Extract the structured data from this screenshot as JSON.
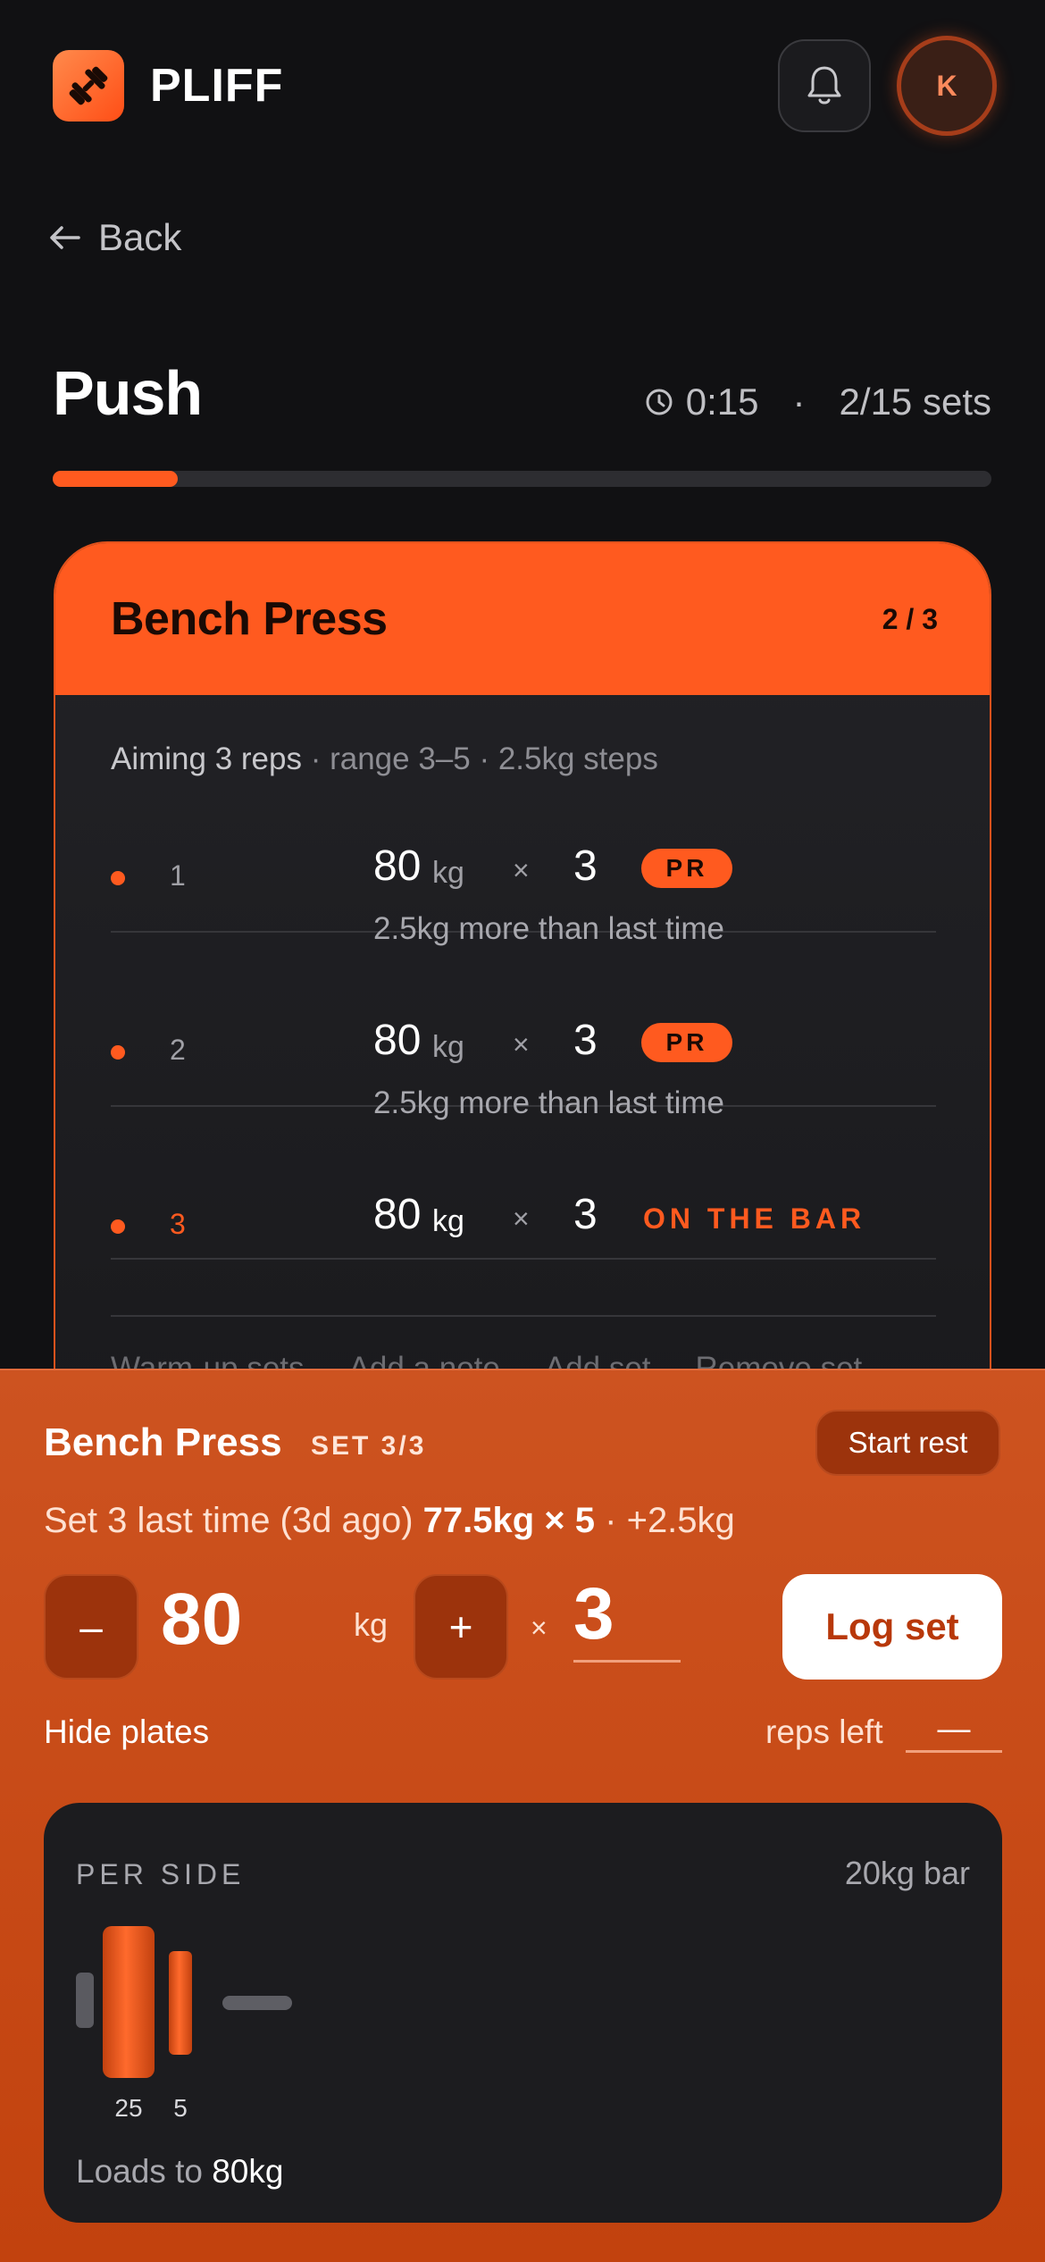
{
  "header": {
    "app_name": "PLIFF",
    "avatar_initial": "K"
  },
  "nav": {
    "back_label": "Back"
  },
  "workout": {
    "title": "Push",
    "timer": "0:15",
    "separator": "·",
    "sets_progress": "2/15 sets",
    "progress_fraction": 0.133
  },
  "exercise_card": {
    "name": "Bench Press",
    "count": "2 / 3",
    "aim_main": "Aiming 3 reps",
    "aim_extra": " · range 3–5 · 2.5kg steps",
    "sets": [
      {
        "number": "1",
        "weight": "80",
        "unit": "kg",
        "times": "×",
        "reps": "3",
        "badge": "PR",
        "note": "2.5kg more than last time"
      },
      {
        "number": "2",
        "weight": "80",
        "unit": "kg",
        "times": "×",
        "reps": "3",
        "badge": "PR",
        "note": "2.5kg more than last time"
      },
      {
        "number": "3",
        "weight": "80",
        "unit": "kg",
        "times": "×",
        "reps": "3",
        "status": "ON THE BAR"
      }
    ],
    "actions": [
      "Warm-up sets",
      "Add a note",
      "Add set",
      "Remove set"
    ]
  },
  "logger": {
    "exercise": "Bench Press",
    "set_label": "SET 3/3",
    "start_rest_label": "Start rest",
    "last_time_prefix": "Set 3 last time (3d ago) ",
    "last_time_value": "77.5kg × 5",
    "last_time_delta": " · +2.5kg",
    "minus_label": "–",
    "plus_label": "+",
    "weight": "80",
    "unit": "kg",
    "times": "×",
    "reps": "3",
    "log_label": "Log set",
    "hide_plates_label": "Hide plates",
    "reps_left_label": "reps left",
    "reps_left_value": "—"
  },
  "plates": {
    "per_side_label": "PER SIDE",
    "bar_label": "20kg bar",
    "items": [
      "25",
      "5"
    ],
    "loads_prefix": "Loads to ",
    "loads_value": "80kg"
  },
  "colors": {
    "accent": "#ff5a1f",
    "background": "#111113",
    "sheet": "#c9490f"
  }
}
